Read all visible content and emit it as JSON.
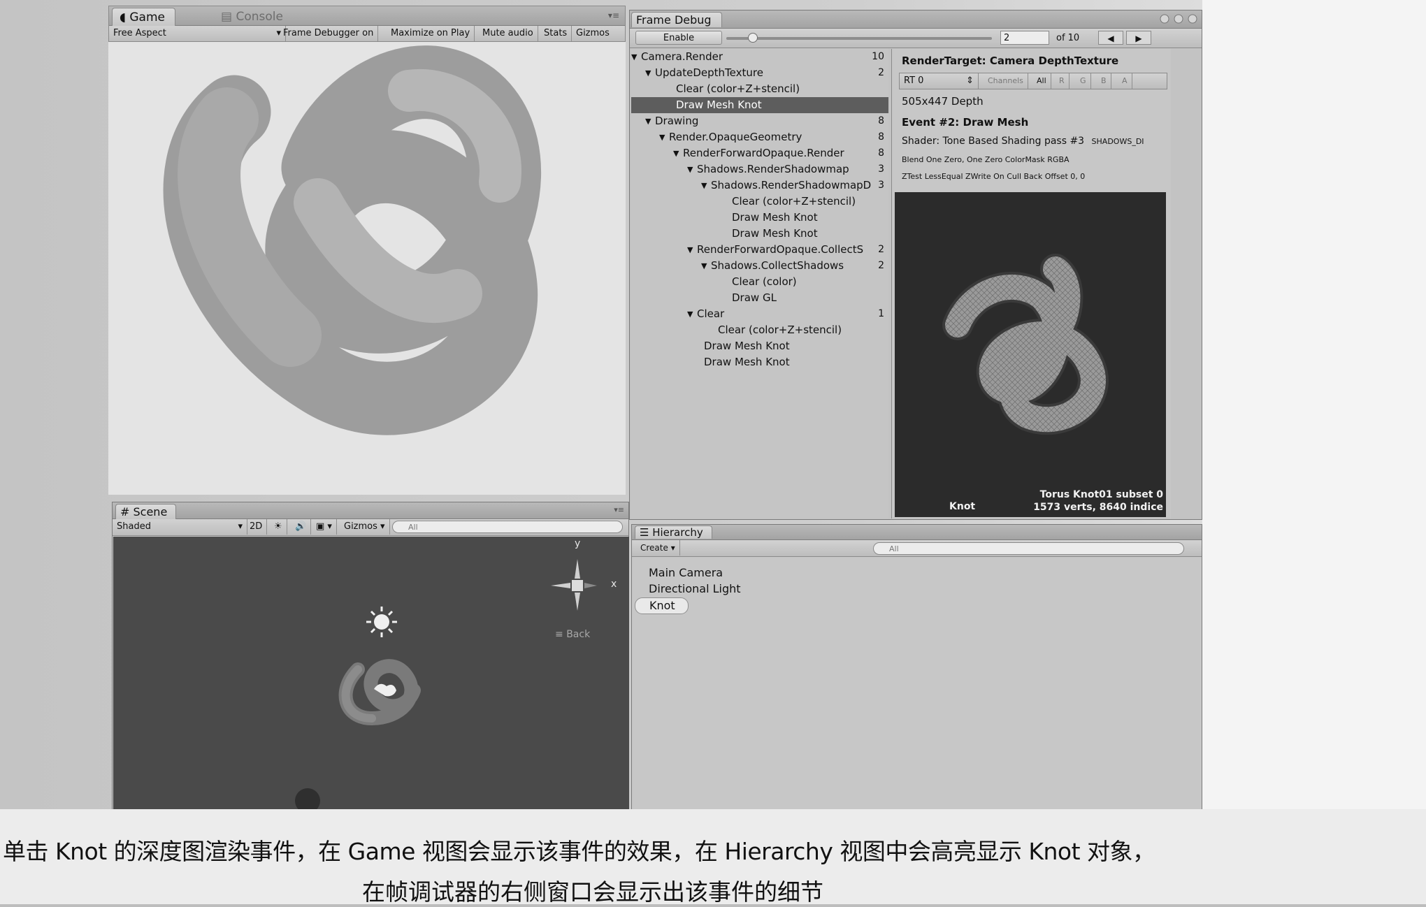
{
  "game": {
    "tab_label": "Game",
    "console_tab_label": "Console",
    "aspect_label": "Free Aspect",
    "toolbar": [
      "Frame Debugger on",
      "Maximize on Play",
      "Mute audio",
      "Stats",
      "Gizmos"
    ]
  },
  "scene": {
    "tab_label": "Scene",
    "shading_label": "Shaded",
    "mode_2d": "2D",
    "gizmos_label": "Gizmos",
    "search_placeholder": "All",
    "axis_y": "y",
    "axis_x": "x",
    "view_label": "Back"
  },
  "frame_debug": {
    "title": "Frame Debug",
    "enable_label": "Enable",
    "current_event": "2",
    "of_total": "of 10",
    "slider_fraction": 0.1,
    "events": [
      {
        "label": "Camera.Render",
        "count": "10",
        "level": 0,
        "expand": true
      },
      {
        "label": "UpdateDepthTexture",
        "count": "2",
        "level": 1,
        "expand": true
      },
      {
        "label": "Clear (color+Z+stencil)",
        "count": "",
        "level": 2,
        "expand": false
      },
      {
        "label": "Draw Mesh Knot",
        "count": "",
        "level": 2,
        "expand": false,
        "selected": true
      },
      {
        "label": "Drawing",
        "count": "8",
        "level": 1,
        "expand": true
      },
      {
        "label": "Render.OpaqueGeometry",
        "count": "8",
        "level": 2,
        "expand": true
      },
      {
        "label": "RenderForwardOpaque.Render",
        "count": "8",
        "level": 3,
        "expand": true
      },
      {
        "label": "Shadows.RenderShadowmap",
        "count": "3",
        "level": 4,
        "expand": true
      },
      {
        "label": "Shadows.RenderShadowmapD",
        "count": "3",
        "level": 5,
        "expand": true
      },
      {
        "label": "Clear (color+Z+stencil)",
        "count": "",
        "level": 6,
        "expand": false
      },
      {
        "label": "Draw Mesh Knot",
        "count": "",
        "level": 6,
        "expand": false
      },
      {
        "label": "Draw Mesh Knot",
        "count": "",
        "level": 6,
        "expand": false
      },
      {
        "label": "RenderForwardOpaque.CollectS",
        "count": "2",
        "level": 4,
        "expand": true
      },
      {
        "label": "Shadows.CollectShadows",
        "count": "2",
        "level": 5,
        "expand": true
      },
      {
        "label": "Clear (color)",
        "count": "",
        "level": 6,
        "expand": false
      },
      {
        "label": "Draw GL",
        "count": "",
        "level": 6,
        "expand": false
      },
      {
        "label": "Clear",
        "count": "1",
        "level": 4,
        "expand": true
      },
      {
        "label": "Clear (color+Z+stencil)",
        "count": "",
        "level": 5,
        "expand": false
      },
      {
        "label": "Draw Mesh Knot",
        "count": "",
        "level": 4,
        "expand": false
      },
      {
        "label": "Draw Mesh Knot",
        "count": "",
        "level": 4,
        "expand": false
      }
    ],
    "detail": {
      "render_target": "RenderTarget: Camera DepthTexture",
      "rt_select": "RT 0",
      "channels_label": "Channels",
      "channel_buttons": [
        "All",
        "R",
        "G",
        "B",
        "A"
      ],
      "resolution": "505x447 Depth",
      "event_title": "Event #2: Draw Mesh",
      "shader": "Shader: Tone Based Shading pass #3",
      "shader_keyword": "SHADOWS_DI",
      "blend": "Blend One Zero, One Zero ColorMask RGBA",
      "ztest": "ZTest LessEqual ZWrite On Cull Back Offset 0, 0",
      "preview_object": "Knot",
      "preview_mesh": "Torus Knot01 subset 0",
      "preview_stats": "1573 verts, 8640 indice"
    }
  },
  "hierarchy": {
    "tab_label": "Hierarchy",
    "create_label": "Create",
    "search_placeholder": "All",
    "items": [
      "Main Camera",
      "Directional Light",
      "Knot"
    ],
    "selected_index": 2
  },
  "caption": {
    "line1": "单击 Knot 的深度图渲染事件，在 Game 视图会显示该事件的效果，在 Hierarchy 视图中会高亮显示 Knot 对象，",
    "line2": "在帧调试器的右侧窗口会显示出该事件的细节"
  }
}
